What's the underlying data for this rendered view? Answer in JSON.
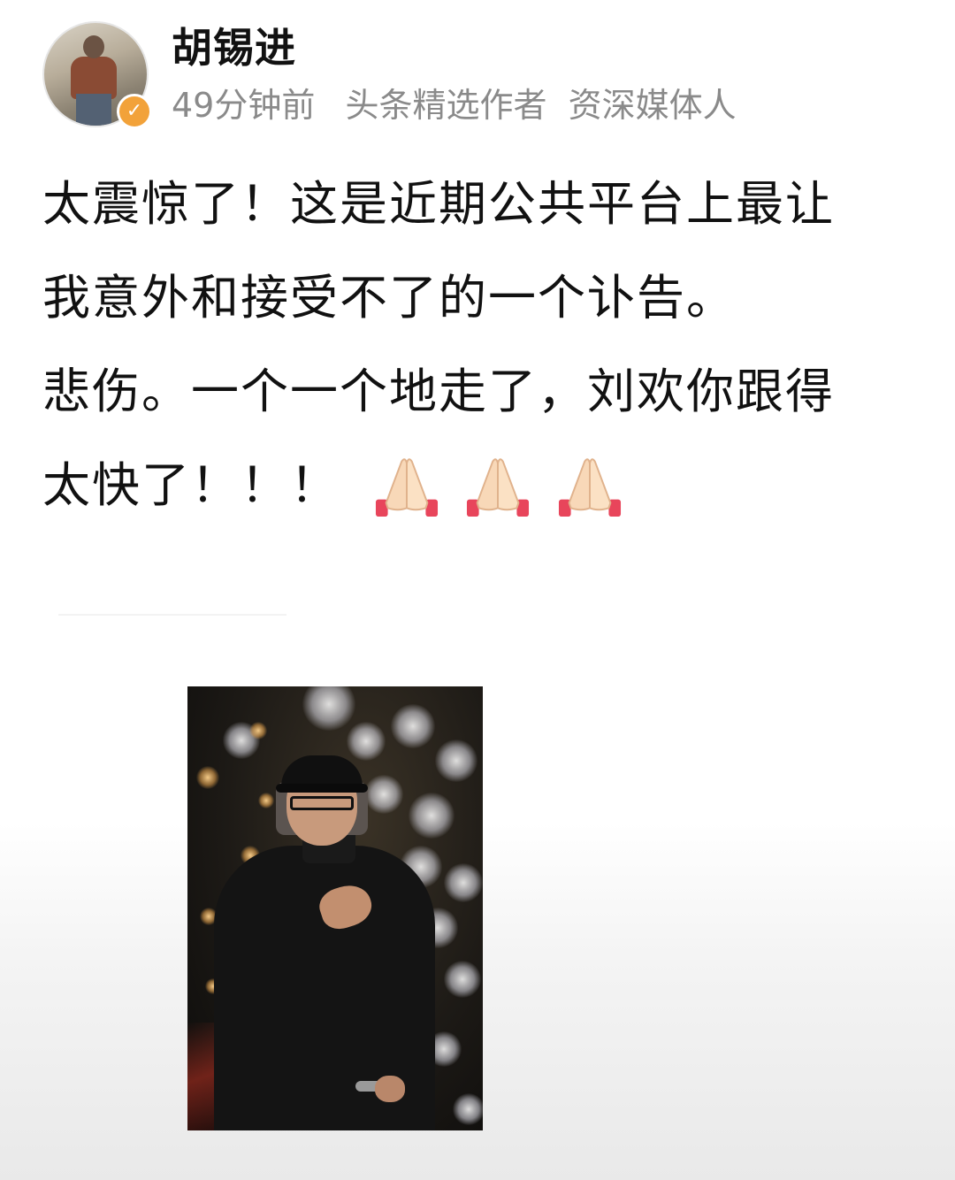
{
  "author": {
    "name": "胡锡进",
    "badge_text": "✓",
    "time": "49分钟前",
    "tags": [
      "头条精选作者",
      "资深媒体人"
    ]
  },
  "post": {
    "lines": [
      "太震惊了！这是近期公共平台上最让",
      "我意外和接受不了的一个讣告。",
      "悲伤。一个一个地走了，刘欢你跟得",
      "太快了！！！"
    ],
    "emoji": [
      "folded-hands-icon",
      "folded-hands-icon",
      "folded-hands-icon"
    ]
  },
  "photo": {
    "subject": "photo of a man in a black cap and glasses, hand on chest, on a stage with lights"
  },
  "colors": {
    "text": "#111111",
    "meta": "#8a8a8a",
    "badge": "#f2a23a"
  }
}
